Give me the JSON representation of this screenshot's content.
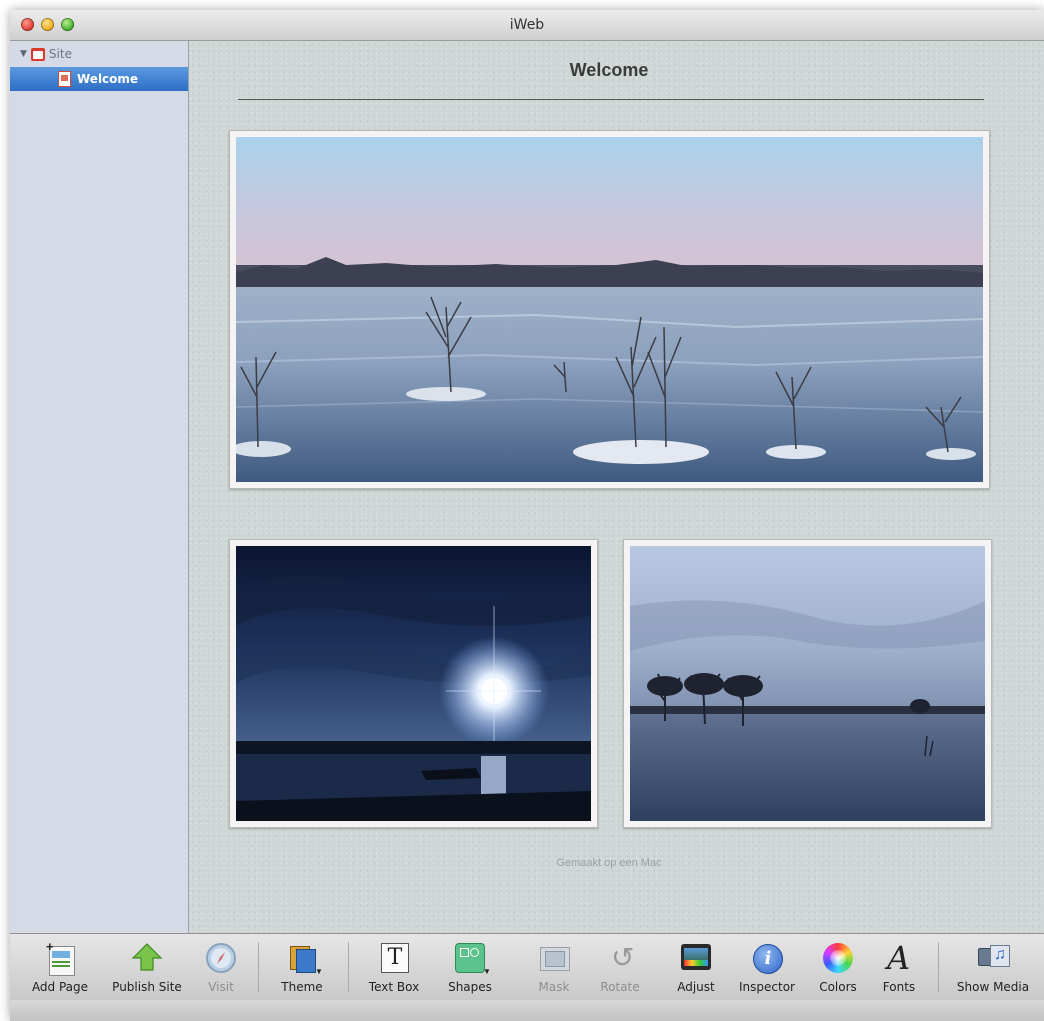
{
  "window": {
    "title": "iWeb"
  },
  "sidebar": {
    "site_label": "Site",
    "pages": [
      {
        "label": "Welcome",
        "selected": true
      }
    ]
  },
  "page": {
    "heading": "Welcome",
    "footer_text": "Gemaakt op een Mac",
    "footer_icon": "apple-icon"
  },
  "toolbar": {
    "items": [
      {
        "label": "Add Page",
        "icon": "add-page-icon",
        "enabled": true
      },
      {
        "label": "Publish Site",
        "icon": "publish-arrow-icon",
        "enabled": true
      },
      {
        "label": "Visit",
        "icon": "compass-icon",
        "enabled": false
      },
      {
        "label": "Theme",
        "icon": "theme-icon",
        "enabled": true
      },
      {
        "label": "Text Box",
        "icon": "text-box-icon",
        "enabled": true
      },
      {
        "label": "Shapes",
        "icon": "shapes-icon",
        "enabled": true
      },
      {
        "label": "Mask",
        "icon": "mask-icon",
        "enabled": false
      },
      {
        "label": "Rotate",
        "icon": "rotate-icon",
        "enabled": false
      },
      {
        "label": "Adjust",
        "icon": "adjust-icon",
        "enabled": true
      },
      {
        "label": "Inspector",
        "icon": "info-icon",
        "enabled": true
      },
      {
        "label": "Colors",
        "icon": "color-wheel-icon",
        "enabled": true
      },
      {
        "label": "Fonts",
        "icon": "fonts-icon",
        "enabled": true
      },
      {
        "label": "Show Media",
        "icon": "media-icon",
        "enabled": true
      }
    ]
  },
  "colors": {
    "selection": "#2e6ec5",
    "sidebar": "#d5dbe6",
    "canvas": "#cfd6d6"
  }
}
